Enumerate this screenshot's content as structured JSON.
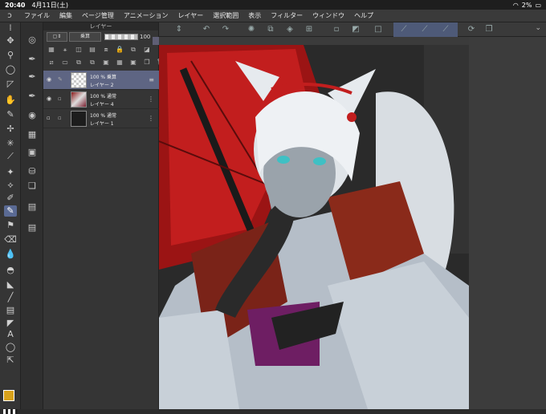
{
  "status": {
    "time": "20:40",
    "date": "4月11日(土)",
    "battery": "2%"
  },
  "menu": [
    "ファイル",
    "編集",
    "ページ管理",
    "アニメーション",
    "レイヤー",
    "選択範囲",
    "表示",
    "フィルター",
    "ウィンドウ",
    "ヘルプ"
  ],
  "layer_panel": {
    "title": "レイヤー",
    "blend_mode": "乗算",
    "opacity": "100",
    "layers": [
      {
        "mode": "100 % 乗算",
        "name": "レイヤー 2",
        "selected": true
      },
      {
        "mode": "100 % 通常",
        "name": "レイヤー 4",
        "selected": false
      },
      {
        "mode": "100 % 通常",
        "name": "レイヤー 1",
        "selected": false
      }
    ]
  },
  "colors": {
    "foreground": "#d9a21b",
    "accent": "#5a6a94",
    "selected_layer": "#5e6583"
  }
}
